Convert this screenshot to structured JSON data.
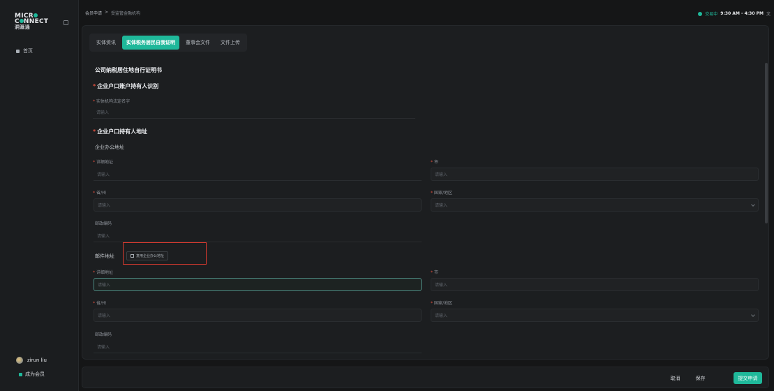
{
  "sidebar": {
    "logo_line1": "MICR",
    "logo_line2": "C",
    "logo_line2b": "NNECT",
    "logo_sub": "洞滙通",
    "home_label": "首页",
    "user_name": "zirun liu",
    "member_label": "成为会员"
  },
  "topbar": {
    "breadcrumb_parent": "会员申请",
    "breadcrumb_sep": ">",
    "breadcrumb_current": "受监管金融机构",
    "market_status": "交易中",
    "market_hours": "9:30 AM - 4:30 PM",
    "translate_glyph": "文"
  },
  "tabs": [
    {
      "label": "实体资讯"
    },
    {
      "label": "实体税务居民自我证明"
    },
    {
      "label": "董事会文件"
    },
    {
      "label": "文件上传"
    }
  ],
  "form": {
    "title": "公司纳税居住地自行证明书",
    "section1": "企业户口账户持有人识别",
    "entity_name_label": "实体机构法定名字",
    "placeholder": "请输入",
    "section2": "企业户口持有人地址",
    "office_address_title": "企业办公地址",
    "detail_address_label": "详细地址",
    "city_label": "市",
    "province_label": "省/州",
    "country_label": "国家/地区",
    "postal_label": "邮政编码",
    "mail_address_title": "邮件地址",
    "copy_office_button": "复用企业办公地址"
  },
  "footer": {
    "cancel": "取消",
    "save": "保存",
    "submit": "提交申请"
  },
  "colors": {
    "accent": "#1fb89a",
    "required": "#e2513f",
    "highlight_box": "#d93a2f"
  }
}
